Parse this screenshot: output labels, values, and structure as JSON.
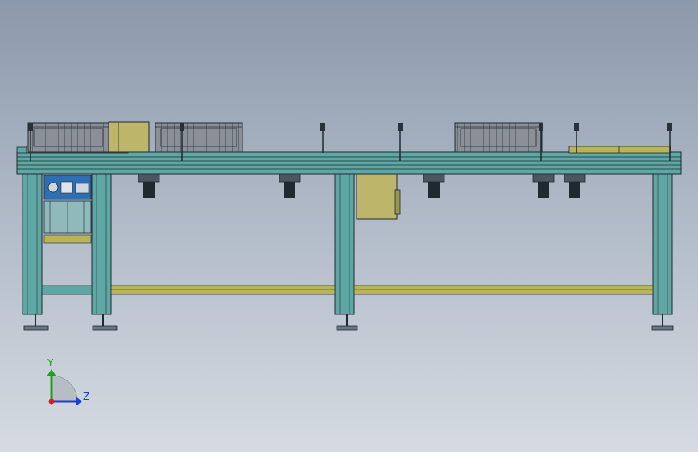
{
  "viewport": {
    "view": "front view",
    "background_top": "#8c98ab",
    "background_bottom": "#d6dbe2"
  },
  "model": {
    "frame_color": "#5fa7a4",
    "rail_color": "#b8b45a",
    "line_color": "#1f2a30",
    "crate_color": "#8a8f98",
    "motor_color": "#bdb66a"
  },
  "triad": {
    "y_label": "Y",
    "z_label": "Z",
    "y_color": "#1ea01e",
    "z_color": "#1e3cd2",
    "x_color": "#d21e1e"
  }
}
